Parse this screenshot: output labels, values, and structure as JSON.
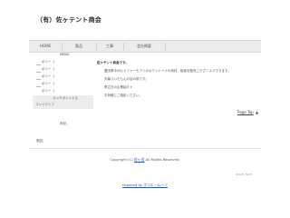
{
  "site": {
    "title": "（有）佐ヶテント商会"
  },
  "nav": {
    "items": [
      {
        "label": "HOME"
      },
      {
        "label": "製品"
      },
      {
        "label": "工事"
      },
      {
        "label": "会社概要"
      }
    ]
  },
  "sidebar": {
    "heading": "MENU",
    "items": [
      {
        "label": "ボリー"
      },
      {
        "label": "ボリー"
      },
      {
        "label": "ボリー"
      },
      {
        "label": "ボリー"
      },
      {
        "label": "ボリー"
      }
    ],
    "bullet": "１",
    "box_title": "オンクボインドス",
    "box_link": "コンドクトフ",
    "footer_text": "来記。"
  },
  "content": {
    "title": "佐ヶテント商会です。",
    "lines": [
      "豊田県中が心ドファーもアリのボテンドーナの商材、取扱を販売ごびざシスパできます。",
      "天幕ついたもんの店の前です。",
      "弊立社の企業紹介ト",
      "お気軽にご相談ください。"
    ]
  },
  "page_top": {
    "label": "Page Top",
    "arrow": "▲"
  },
  "bottom_note": "来記。",
  "footer": {
    "copyright_prefix": "Copyright (C)",
    "copyright_link": "佐ヶ会",
    "copyright_suffix": "All Rights Reserved.",
    "small_tag": "ROOM_NUM",
    "powered_by": "Powered by ボコエ・ムーゾ"
  }
}
